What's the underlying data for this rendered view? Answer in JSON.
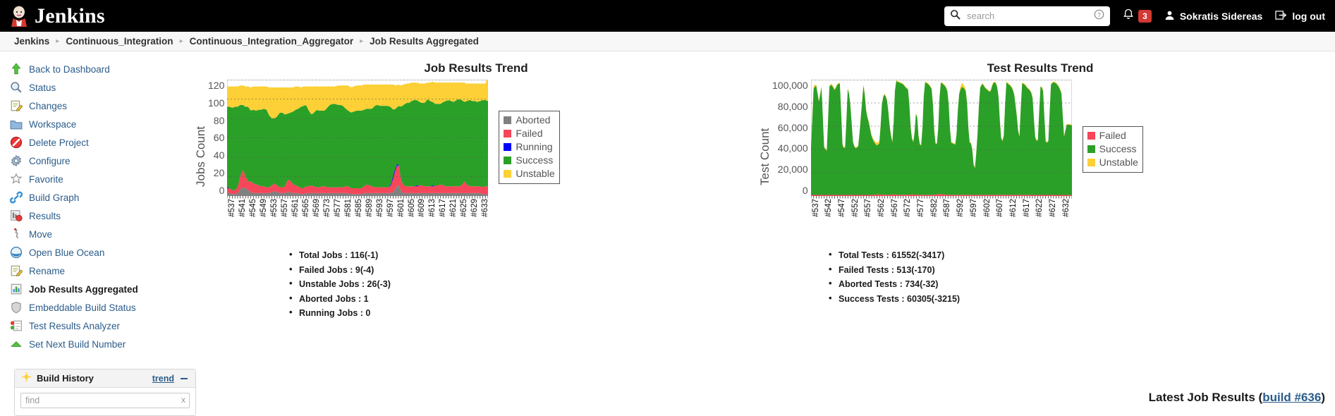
{
  "header": {
    "brand": "Jenkins",
    "search": {
      "placeholder": "search",
      "value": ""
    },
    "notifications_count": "3",
    "user": "Sokratis Sidereas",
    "logout": "log out"
  },
  "breadcrumbs": [
    "Jenkins",
    "Continuous_Integration",
    "Continuous_Integration_Aggregator",
    "Job Results Aggregated"
  ],
  "sidebar": {
    "items": [
      {
        "label": "Back to Dashboard",
        "icon": "up-arrow-icon",
        "current": false
      },
      {
        "label": "Status",
        "icon": "magnifier-icon",
        "current": false
      },
      {
        "label": "Changes",
        "icon": "notepad-pencil-icon",
        "current": false
      },
      {
        "label": "Workspace",
        "icon": "folder-icon",
        "current": false
      },
      {
        "label": "Delete Project",
        "icon": "no-entry-icon",
        "current": false
      },
      {
        "label": "Configure",
        "icon": "gear-icon",
        "current": false
      },
      {
        "label": "Favorite",
        "icon": "star-icon",
        "current": false
      },
      {
        "label": "Build Graph",
        "icon": "link-icon",
        "current": false
      },
      {
        "label": "Results",
        "icon": "chart-pie-icon",
        "current": false
      },
      {
        "label": "Move",
        "icon": "move-icon",
        "current": false
      },
      {
        "label": "Open Blue Ocean",
        "icon": "blue-ocean-icon",
        "current": false
      },
      {
        "label": "Rename",
        "icon": "notepad-pencil-icon",
        "current": false
      },
      {
        "label": "Job Results Aggregated",
        "icon": "bar-chart-icon",
        "current": true
      },
      {
        "label": "Embeddable Build Status",
        "icon": "shield-icon",
        "current": false
      },
      {
        "label": "Test Results Analyzer",
        "icon": "test-list-icon",
        "current": false
      },
      {
        "label": "Set Next Build Number",
        "icon": "green-arrow-icon",
        "current": false
      }
    ],
    "build_history": {
      "title": "Build History",
      "trend_label": "trend",
      "find_placeholder": "find",
      "find_value": "",
      "clear_label": "x"
    }
  },
  "main": {
    "latest_prefix": "Latest Job Results (",
    "latest_link": "build #636",
    "latest_suffix": ")",
    "job_bullets": [
      "Total Jobs : 116(-1)",
      "Failed Jobs : 9(-4)",
      "Unstable Jobs : 26(-3)",
      "Aborted Jobs : 1",
      "Running Jobs : 0"
    ],
    "test_bullets": [
      "Total Tests : 61552(-3417)",
      "Failed Tests : 513(-170)",
      "Aborted Tests : 734(-32)",
      "Success Tests : 60305(-3215)"
    ]
  },
  "colors": {
    "aborted": "#808080",
    "failed": "#f6465a",
    "running": "#0000ff",
    "success": "#2ba028",
    "unstable": "#fcd036",
    "link": "#2b5c8a",
    "brand_bg": "#000000",
    "badge": "#d33833"
  },
  "chart_data": [
    {
      "type": "area",
      "name": "job-results-trend",
      "title": "Job Results Trend",
      "xlabel": "",
      "ylabel": "Jobs Count",
      "ylim": [
        0,
        120
      ],
      "yticks": [
        0,
        20,
        40,
        60,
        80,
        100,
        120
      ],
      "grid": true,
      "legend_position": "right",
      "stacked": true,
      "xtick_labels": [
        "#537",
        "#541",
        "#545",
        "#549",
        "#553",
        "#557",
        "#561",
        "#565",
        "#569",
        "#573",
        "#577",
        "#581",
        "#585",
        "#589",
        "#593",
        "#597",
        "#601",
        "#605",
        "#609",
        "#613",
        "#617",
        "#621",
        "#625",
        "#629",
        "#633"
      ],
      "x_start": 537,
      "x_end": 636,
      "series": [
        {
          "name": "Aborted",
          "color": "#808080",
          "values": [
            3,
            3,
            2,
            2,
            3,
            7,
            9,
            8,
            6,
            4,
            3,
            3,
            3,
            3,
            3,
            3,
            3,
            4,
            5,
            4,
            3,
            3,
            3,
            4,
            4,
            3,
            3,
            3,
            2,
            2,
            3,
            3,
            3,
            3,
            3,
            3,
            3,
            3,
            3,
            3,
            3,
            3,
            3,
            3,
            3,
            3,
            3,
            2,
            2,
            2,
            2,
            2,
            3,
            3,
            3,
            3,
            3,
            3,
            3,
            3,
            3,
            3,
            3,
            4,
            8,
            12,
            5,
            3,
            3,
            3,
            3,
            3,
            3,
            3,
            3,
            3,
            3,
            3,
            3,
            3,
            3,
            3,
            3,
            3,
            3,
            3,
            3,
            3,
            3,
            3,
            3,
            3,
            3,
            3,
            3,
            3,
            3,
            2,
            2,
            1
          ]
        },
        {
          "name": "Failed",
          "color": "#f6465a",
          "values": [
            5,
            5,
            4,
            4,
            6,
            13,
            18,
            12,
            9,
            11,
            10,
            9,
            8,
            7,
            7,
            6,
            6,
            7,
            8,
            7,
            6,
            6,
            7,
            13,
            12,
            9,
            8,
            7,
            6,
            6,
            7,
            7,
            8,
            7,
            6,
            6,
            7,
            7,
            6,
            6,
            6,
            6,
            6,
            6,
            6,
            7,
            7,
            6,
            6,
            6,
            6,
            6,
            7,
            9,
            8,
            7,
            6,
            6,
            6,
            6,
            6,
            6,
            7,
            14,
            20,
            22,
            11,
            8,
            7,
            7,
            7,
            7,
            7,
            8,
            8,
            7,
            7,
            7,
            7,
            7,
            8,
            9,
            8,
            7,
            7,
            7,
            7,
            7,
            7,
            8,
            12,
            9,
            7,
            7,
            7,
            7,
            7,
            7,
            8,
            9
          ]
        },
        {
          "name": "Running",
          "color": "#0000ff",
          "values": [
            1,
            0,
            0,
            0,
            0,
            0,
            0,
            0,
            0,
            0,
            0,
            0,
            0,
            0,
            0,
            0,
            0,
            0,
            0,
            0,
            0,
            0,
            0,
            0,
            0,
            0,
            0,
            0,
            0,
            0,
            0,
            0,
            0,
            0,
            0,
            0,
            0,
            0,
            0,
            0,
            0,
            0,
            0,
            0,
            0,
            0,
            0,
            0,
            0,
            0,
            0,
            0,
            0,
            0,
            0,
            0,
            0,
            0,
            0,
            0,
            0,
            0,
            1,
            3,
            2,
            1,
            0,
            0,
            0,
            0,
            0,
            0,
            1,
            0,
            0,
            0,
            0,
            0,
            1,
            0,
            0,
            0,
            0,
            0,
            0,
            0,
            0,
            0,
            0,
            0,
            0,
            0,
            0,
            0,
            0,
            0,
            0,
            0,
            0,
            0
          ]
        },
        {
          "name": "Success",
          "color": "#2ba028",
          "values": [
            83,
            84,
            85,
            86,
            83,
            74,
            67,
            72,
            77,
            73,
            76,
            76,
            78,
            79,
            80,
            80,
            74,
            69,
            67,
            71,
            77,
            77,
            74,
            68,
            70,
            75,
            78,
            80,
            84,
            85,
            84,
            78,
            73,
            76,
            80,
            79,
            78,
            78,
            82,
            85,
            86,
            86,
            85,
            85,
            84,
            80,
            78,
            78,
            79,
            80,
            80,
            80,
            79,
            78,
            79,
            80,
            84,
            85,
            84,
            84,
            84,
            84,
            81,
            68,
            60,
            58,
            76,
            83,
            86,
            86,
            88,
            89,
            88,
            86,
            85,
            86,
            90,
            88,
            86,
            85,
            84,
            83,
            86,
            88,
            89,
            88,
            87,
            89,
            90,
            88,
            82,
            86,
            89,
            88,
            88,
            87,
            88,
            90,
            89,
            88
          ]
        },
        {
          "name": "Unstable",
          "color": "#fcd036",
          "values": [
            21,
            21,
            22,
            21,
            21,
            20,
            20,
            21,
            21,
            24,
            24,
            25,
            24,
            24,
            23,
            24,
            29,
            32,
            32,
            30,
            26,
            26,
            28,
            27,
            26,
            25,
            24,
            23,
            20,
            20,
            19,
            25,
            29,
            27,
            24,
            25,
            25,
            25,
            22,
            19,
            18,
            18,
            20,
            20,
            21,
            24,
            26,
            26,
            26,
            26,
            26,
            26,
            26,
            25,
            25,
            25,
            22,
            21,
            22,
            22,
            22,
            22,
            23,
            26,
            24,
            22,
            22,
            21,
            20,
            20,
            19,
            18,
            18,
            19,
            20,
            20,
            17,
            19,
            21,
            22,
            22,
            22,
            20,
            19,
            18,
            19,
            20,
            18,
            17,
            18,
            20,
            18,
            17,
            18,
            18,
            19,
            18,
            17,
            17,
            26
          ]
        }
      ]
    },
    {
      "type": "area",
      "name": "test-results-trend",
      "title": "Test Results Trend",
      "xlabel": "",
      "ylabel": "Test Count",
      "ylim": [
        0,
        100000
      ],
      "yticks": [
        0,
        20000,
        40000,
        60000,
        80000,
        100000
      ],
      "ytick_labels": [
        "0",
        "20,000",
        "40,000",
        "60,000",
        "80,000",
        "100,000"
      ],
      "grid": true,
      "legend_position": "right",
      "stacked": true,
      "xtick_labels": [
        "#537",
        "#542",
        "#547",
        "#552",
        "#557",
        "#562",
        "#567",
        "#572",
        "#577",
        "#582",
        "#587",
        "#592",
        "#597",
        "#602",
        "#607",
        "#612",
        "#617",
        "#622",
        "#627",
        "#632"
      ],
      "x_start": 537,
      "x_end": 636,
      "series": [
        {
          "name": "Failed",
          "color": "#f6465a",
          "values": [
            900,
            900,
            900,
            900,
            900,
            900,
            900,
            900,
            900,
            900,
            900,
            900,
            900,
            900,
            900,
            900,
            900,
            900,
            900,
            900,
            900,
            900,
            900,
            900,
            1200,
            1400,
            1200,
            1100,
            1000,
            1000,
            1400,
            1300,
            1100,
            1000,
            1000,
            1000,
            1100,
            1200,
            1300,
            1100,
            1000,
            1000,
            1000,
            1000,
            1000,
            1000,
            1100,
            1500,
            1700,
            1500,
            1200,
            1000,
            1000,
            1000,
            1000,
            1000,
            1000,
            1000,
            1000,
            1000,
            1000,
            1000,
            1000,
            1000,
            1000,
            1000,
            1000,
            1000,
            1000,
            1000,
            1000,
            1000,
            1000,
            1000,
            1000,
            1000,
            1000,
            1000,
            1000,
            1000,
            1000,
            1000,
            900,
            900,
            900,
            900,
            900,
            900,
            900,
            900,
            900,
            900,
            900,
            900,
            900,
            900,
            900,
            513
          ]
        },
        {
          "name": "Success",
          "color": "#2ba028",
          "values": [
            41000,
            92000,
            94000,
            80000,
            93000,
            40000,
            38000,
            95000,
            94000,
            90000,
            95000,
            96000,
            40000,
            41000,
            95000,
            76000,
            43000,
            40000,
            42000,
            70000,
            97000,
            70000,
            62000,
            50000,
            45000,
            42000,
            44000,
            82000,
            87000,
            80000,
            55000,
            43000,
            98000,
            97000,
            96000,
            95000,
            92000,
            90000,
            50000,
            44000,
            76000,
            44000,
            42000,
            97000,
            96000,
            94000,
            90000,
            44000,
            43000,
            96000,
            95000,
            93000,
            88000,
            45000,
            44000,
            43000,
            85000,
            93000,
            92000,
            88000,
            45000,
            44000,
            18000,
            44000,
            91000,
            96000,
            92000,
            90000,
            88000,
            96000,
            97000,
            90000,
            50000,
            44000,
            97000,
            95000,
            93000,
            88000,
            70000,
            45000,
            96000,
            95000,
            92000,
            90000,
            86000,
            50000,
            44000,
            93000,
            92000,
            46000,
            44000,
            95000,
            97000,
            96000,
            93000,
            88000,
            50000,
            60305,
            60305,
            60305
          ]
        },
        {
          "name": "Unstable",
          "color": "#fcd036",
          "values": [
            700,
            2500,
            700,
            700,
            700,
            700,
            700,
            700,
            1500,
            700,
            700,
            700,
            700,
            700,
            700,
            700,
            700,
            700,
            700,
            700,
            700,
            700,
            700,
            1500,
            2000,
            2500,
            700,
            700,
            700,
            700,
            700,
            700,
            700,
            700,
            700,
            700,
            700,
            700,
            700,
            700,
            700,
            700,
            700,
            700,
            700,
            700,
            700,
            700,
            700,
            700,
            700,
            700,
            700,
            700,
            700,
            700,
            3500,
            2500,
            700,
            700,
            700,
            700,
            700,
            700,
            700,
            700,
            700,
            700,
            700,
            700,
            700,
            700,
            700,
            700,
            700,
            700,
            700,
            700,
            700,
            700,
            700,
            700,
            700,
            700,
            700,
            700,
            700,
            700,
            700,
            700,
            700,
            700,
            700,
            700,
            734,
            734,
            734,
            734
          ]
        }
      ]
    }
  ]
}
